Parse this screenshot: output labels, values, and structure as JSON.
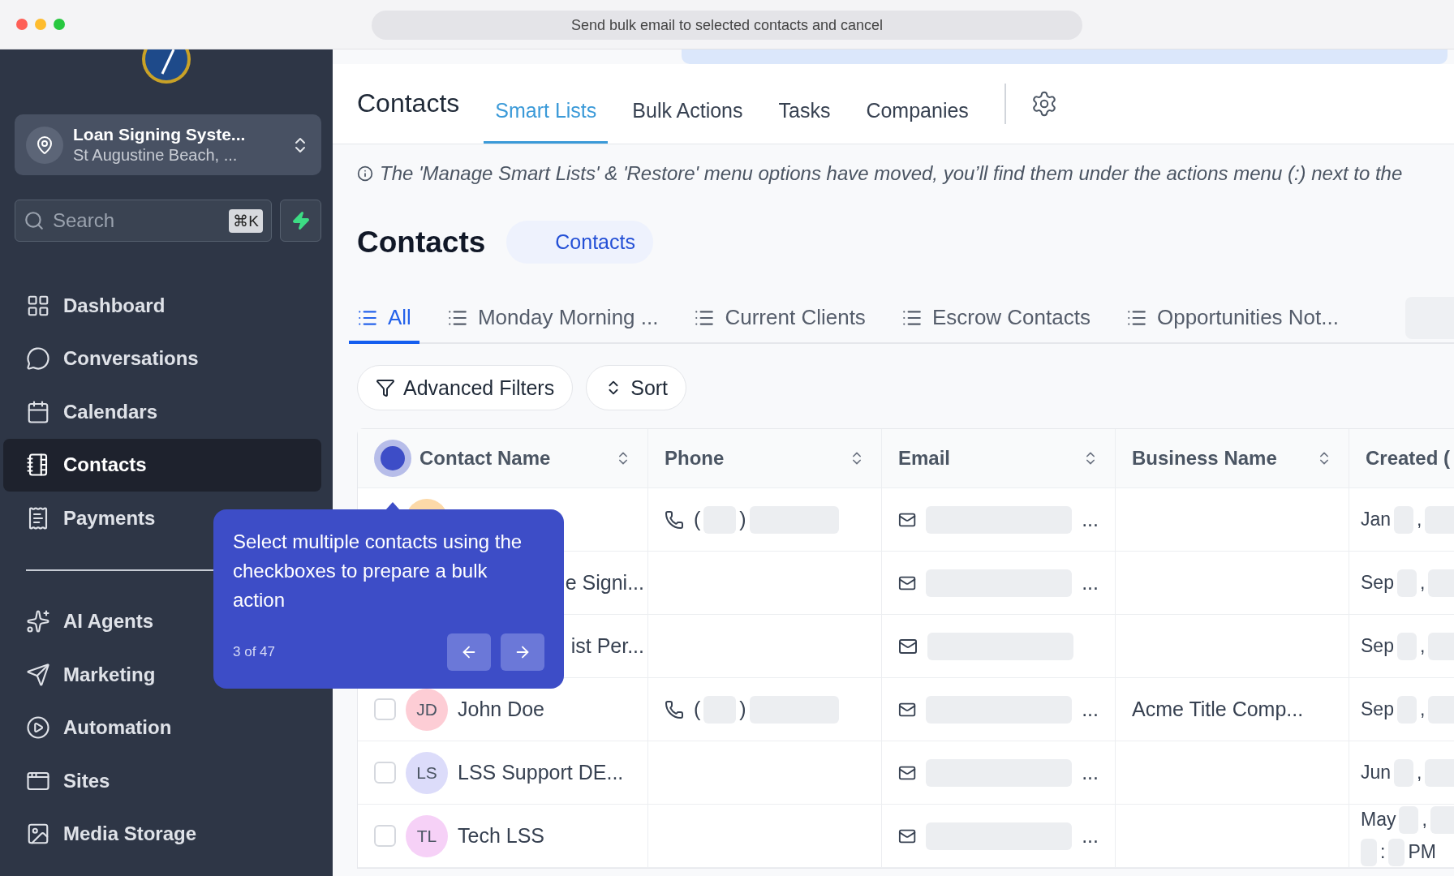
{
  "window": {
    "title": "Send bulk email to selected contacts and cancel"
  },
  "sidebar": {
    "account": {
      "name": "Loan Signing Syste...",
      "location": "St Augustine Beach, ..."
    },
    "search": {
      "placeholder": "Search",
      "shortcut": "⌘K"
    },
    "nav_groups": [
      [
        {
          "label": "Dashboard",
          "selected": false
        },
        {
          "label": "Conversations",
          "selected": false
        },
        {
          "label": "Calendars",
          "selected": false
        },
        {
          "label": "Contacts",
          "selected": true
        },
        {
          "label": "Payments",
          "selected": false
        }
      ],
      [
        {
          "label": "AI Agents",
          "selected": false
        },
        {
          "label": "Marketing",
          "selected": false
        },
        {
          "label": "Automation",
          "selected": false
        },
        {
          "label": "Sites",
          "selected": false
        },
        {
          "label": "Media Storage",
          "selected": false
        }
      ]
    ]
  },
  "header": {
    "title": "Contacts",
    "tabs": [
      {
        "label": "Smart Lists",
        "selected": true
      },
      {
        "label": "Bulk Actions",
        "selected": false
      },
      {
        "label": "Tasks",
        "selected": false
      },
      {
        "label": "Companies",
        "selected": false
      }
    ]
  },
  "notice": "The 'Manage Smart Lists' & 'Restore' menu options have moved, you’ll find them under the actions menu (:) next to the",
  "page": {
    "title": "Contacts",
    "badge": "Contacts"
  },
  "lists": [
    {
      "label": "All",
      "selected": true
    },
    {
      "label": "Monday Morning ...",
      "selected": false
    },
    {
      "label": "Current Clients",
      "selected": false
    },
    {
      "label": "Escrow Contacts",
      "selected": false
    },
    {
      "label": "Opportunities Not...",
      "selected": false
    }
  ],
  "actions": [
    "Advanced Filters",
    "Sort"
  ],
  "table": {
    "select_all_highlighted": true,
    "columns": [
      "Contact Name",
      "Phone",
      "Email",
      "Business Name",
      "Created ("
    ],
    "rows": [
      {
        "color": "#fcd9a8",
        "phone": [
          "(",
          ")"
        ],
        "email_end": "...",
        "created": [
          [
            "Jan",
            ","
          ]
        ]
      },
      {
        "name": "e Signi...",
        "email_end": "...",
        "created": [
          [
            "Sep",
            ","
          ]
        ]
      },
      {
        "name": "ist Per...",
        "created": [
          [
            "Sep",
            ","
          ]
        ]
      },
      {
        "selected": false,
        "initials": "JD",
        "color": "#fdcdd5",
        "name": "John Doe",
        "phone": [
          "(",
          ")"
        ],
        "email_end": "...",
        "business": "Acme Title Comp...",
        "created": [
          [
            "Sep",
            ","
          ]
        ]
      },
      {
        "selected": false,
        "initials": "LS",
        "color": "#dcdcfa",
        "name": "LSS Support DE...",
        "email_end": "...",
        "created": [
          [
            "Jun",
            ","
          ]
        ]
      },
      {
        "selected": false,
        "initials": "TL",
        "color": "#f6d1f7",
        "name": "Tech LSS",
        "email_end": "...",
        "created": [
          [
            "May",
            ","
          ],
          [
            ":",
            "PM"
          ]
        ]
      }
    ]
  },
  "tour": {
    "text": "Select multiple contacts using the checkboxes to prepare a bulk action",
    "step": "3 of 47"
  }
}
